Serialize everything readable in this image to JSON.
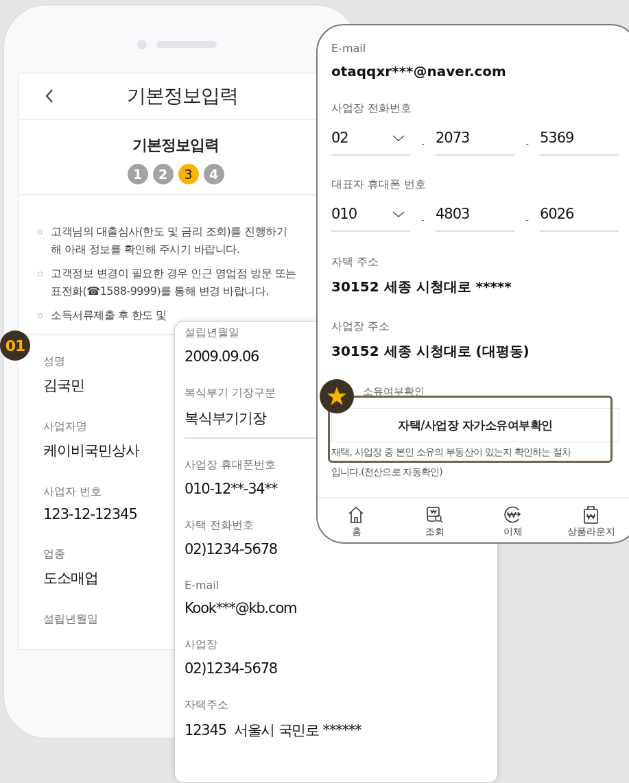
{
  "left_screen": {
    "header_title": "기본정보입력",
    "page_title": "기본정보입력",
    "steps": [
      {
        "label": "1",
        "selected": false
      },
      {
        "label": "2",
        "selected": false
      },
      {
        "label": "3",
        "selected": true
      },
      {
        "label": "4",
        "selected": false
      }
    ],
    "notices": [
      {
        "lines": [
          "고객님의 대출심사(한도 및 금리 조회)를 진행하기",
          "해 아래 정보를 확인해 주시기 바랍니다."
        ]
      },
      {
        "lines": [
          "고객정보 변경이 필요한 경우 인근 영업점 방문 또는",
          "표전화(☎1588-9999)를 통해 변경 바랍니다."
        ]
      },
      {
        "lines": [
          "소득서류제출 후 한도 및"
        ]
      }
    ],
    "fields": [
      {
        "label": "성명",
        "value": "김국민"
      },
      {
        "label": "사업자명",
        "value": "케이비국민상사"
      },
      {
        "label": "사업자 번호",
        "value": "123-12-12345"
      },
      {
        "label": "업종",
        "value": "도소매업"
      },
      {
        "label": "설립년월일"
      }
    ]
  },
  "step_badge": "01",
  "middle_card": {
    "fields": [
      {
        "label": "설립년월일",
        "value": "2009.09.06",
        "kind": "plain"
      },
      {
        "label": "복식부기 기장구분",
        "value": "복식부기기장",
        "kind": "underlined"
      },
      {
        "label": "사업장 휴대폰번호",
        "value": "010-12**-34**",
        "kind": "plain"
      },
      {
        "label": "자택 전화번호",
        "value": "02)1234-5678",
        "kind": "plain"
      },
      {
        "label": "E-mail",
        "value": "Kook***@kb.com",
        "kind": "plain"
      },
      {
        "label": "사업장",
        "value": "02)1234-5678",
        "kind": "plain"
      },
      {
        "label": "자택주소",
        "value": "12345  서울시 국민로 ******",
        "kind": "plain"
      }
    ]
  },
  "right_card": {
    "email": {
      "label": "E-mail",
      "value": "otaqqxr***@naver.com"
    },
    "phones": [
      {
        "label": "사업장 전화번호",
        "parts": [
          "02",
          "2073",
          "5369"
        ],
        "separators": [
          "-",
          "-"
        ]
      },
      {
        "label": "대표자 휴대폰 번호",
        "parts": [
          "010",
          "4803",
          "6026"
        ],
        "separators": [
          "-",
          "-"
        ]
      }
    ],
    "addresses": [
      {
        "label": "자택 주소",
        "value": "30152 세종 시청대로 *****"
      },
      {
        "label": "사업장 주소",
        "value": "30152 세종 시청대로 (대평동)"
      }
    ],
    "ownership": {
      "label": "소유여부확인",
      "button": "자택/사업장 자가소유여부확인",
      "note": "재택, 사업장 중 본인 소유의 부동산이 있는지 확인하는 절차 입니다.(전산으로 자동확인)"
    },
    "nav": [
      {
        "label": "홈",
        "kind": "home"
      },
      {
        "label": "조회",
        "kind": "inquiry"
      },
      {
        "label": "이체",
        "kind": "transfer"
      },
      {
        "label": "상품라운지",
        "kind": "shop"
      }
    ]
  }
}
